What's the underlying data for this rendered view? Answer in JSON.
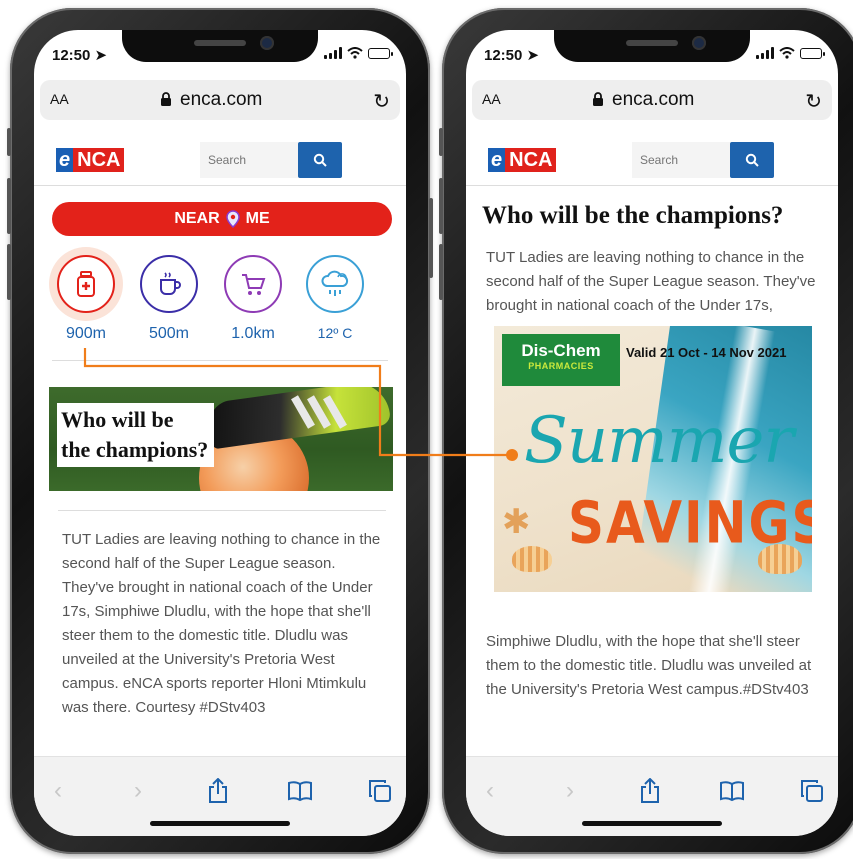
{
  "status_bar": {
    "time": "12:50"
  },
  "browser": {
    "text_size_label": "AA",
    "domain": "enca.com"
  },
  "site": {
    "logo_e": "e",
    "logo_nca": "NCA",
    "search_placeholder": "Search"
  },
  "near_me": {
    "label_left": "NEAR",
    "label_right": "ME"
  },
  "widgets": [
    {
      "icon": "medicine-bottle-icon",
      "value": "900m",
      "color": "#e3221a"
    },
    {
      "icon": "coffee-cup-icon",
      "value": "500m",
      "color": "#3b2ea8"
    },
    {
      "icon": "shopping-cart-icon",
      "value": "1.0km",
      "color": "#8e3bb5"
    },
    {
      "icon": "weather-rain-icon",
      "value": "12º C",
      "color": "#3aa0d6"
    }
  ],
  "article": {
    "hero_title_line1": "Who will be",
    "hero_title_line2": "the champions?",
    "title": "Who will be the champions?",
    "full_body": "TUT Ladies are leaving nothing to chance in the second half of the Super League season. They've brought in national coach of the Under 17s, Simphiwe Dludlu, with the hope that she'll steer them to the domestic title. Dludlu was unveiled at the University's Pretoria West campus. eNCA sports reporter Hloni Mtimkulu was there. Courtesy #DStv403",
    "intro_split": "TUT Ladies are leaving nothing to chance in the second half of the Super League season. They've brought in national coach of the Under 17s,",
    "outro_split": "Simphiwe Dludlu, with the hope that she'll steer them to the domestic title. Dludlu was unveiled at the University's Pretoria West campus.#DStv403"
  },
  "ad": {
    "brand_name": "Dis-Chem",
    "brand_sub": "PHARMACIES",
    "valid": "Valid 21 Oct - 14 Nov 2021",
    "headline_script": "Summer",
    "headline_bold": "SAVINGS"
  },
  "colors": {
    "accent_red": "#e3221a",
    "link_blue": "#1e63ad",
    "connector_orange": "#f07d1a",
    "brand_green": "#1f8a3b"
  }
}
